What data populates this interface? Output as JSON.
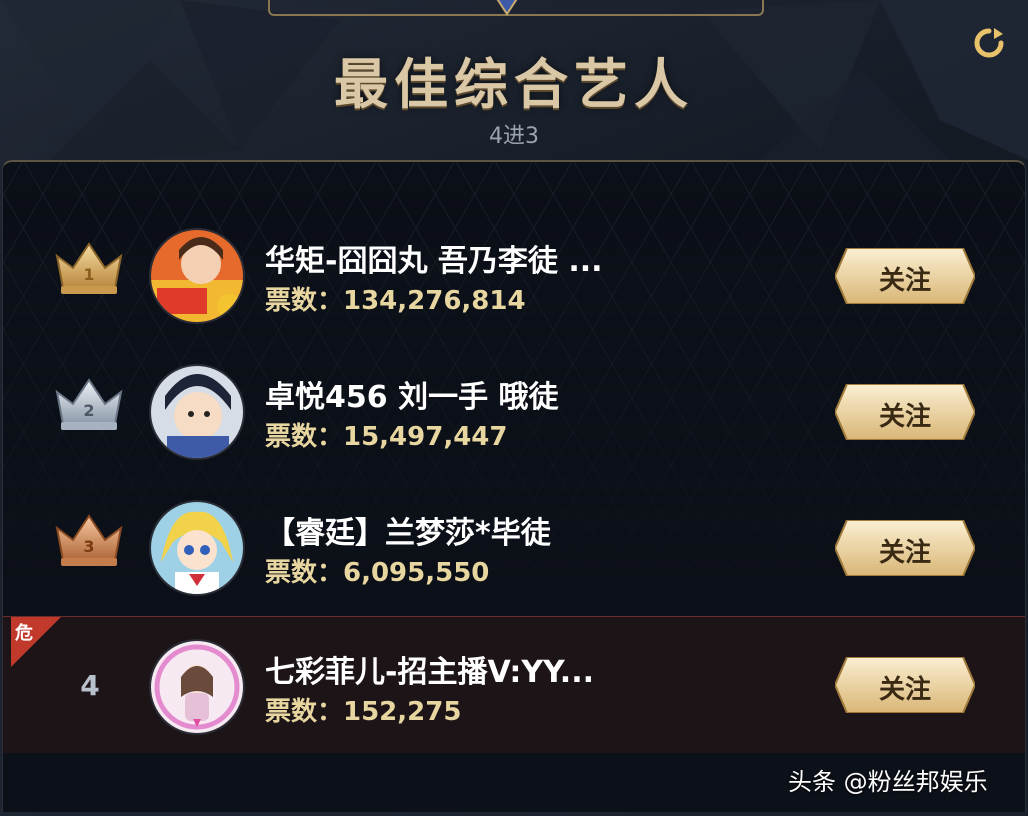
{
  "header": {
    "title": "最佳综合艺人",
    "subtitle": "4进3",
    "refresh_icon": "refresh-icon"
  },
  "ranking": [
    {
      "rank": "1",
      "badge": "gold-crown",
      "name": "华矩-囧囧丸 吾乃李徒 ...",
      "votes": "票数：134,276,814",
      "follow": "关注"
    },
    {
      "rank": "2",
      "badge": "silver-crown",
      "name": "卓悦456 刘一手 哦徒",
      "votes": "票数：15,497,447",
      "follow": "关注"
    },
    {
      "rank": "3",
      "badge": "bronze-crown",
      "name": "【睿廷】兰梦莎*毕徒",
      "votes": "票数：6,095,550",
      "follow": "关注"
    },
    {
      "rank": "4",
      "badge": "danger",
      "danger_label": "危",
      "name": "七彩菲儿-招主播V:YY...",
      "votes": "票数：152,275",
      "follow": "关注"
    }
  ],
  "watermark": "头条 @粉丝邦娱乐",
  "colors": {
    "title": "#d9c7a6",
    "votes": "#e8d6a0",
    "button_gold": "#e9d2a0",
    "danger": "#c0392b"
  }
}
